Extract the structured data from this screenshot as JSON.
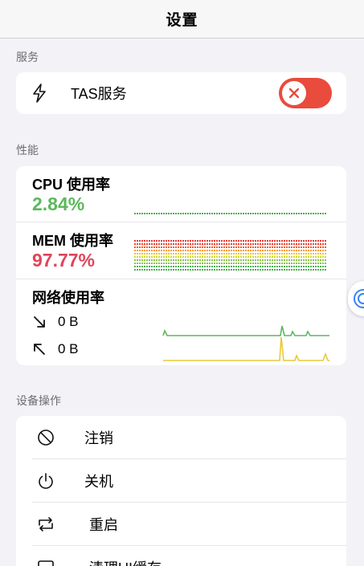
{
  "nav": {
    "title": "设置"
  },
  "services": {
    "section_label": "服务",
    "tas": {
      "label": "TAS服务",
      "enabled": false,
      "icon": "bolt-icon"
    }
  },
  "performance": {
    "section_label": "性能",
    "cpu": {
      "title": "CPU 使用率",
      "value": "2.84%",
      "color": "#5cb85c",
      "level": 0.0284
    },
    "mem": {
      "title": "MEM 使用率",
      "value": "97.77%",
      "color": "#e0445a",
      "level": 0.9777
    },
    "network": {
      "title": "网络使用率",
      "download": {
        "icon": "arrow-down-right-icon",
        "value": "0 B"
      },
      "upload": {
        "icon": "arrow-up-left-icon",
        "value": "0 B"
      }
    }
  },
  "device_ops": {
    "section_label": "设备操作",
    "items": [
      {
        "label": "注销",
        "icon": "prohibited-icon"
      },
      {
        "label": "关机",
        "icon": "power-icon"
      },
      {
        "label": "重启",
        "icon": "restart-icon"
      },
      {
        "label": "清理UI缓存",
        "icon": "cache-icon"
      }
    ]
  },
  "colors": {
    "background": "#f2f2f7",
    "toggle_off": "#e94b3c",
    "cpu_green": "#5cb85c",
    "mem_red": "#e0445a",
    "net_download": "#5cb85c",
    "net_upload": "#e8c93a"
  }
}
